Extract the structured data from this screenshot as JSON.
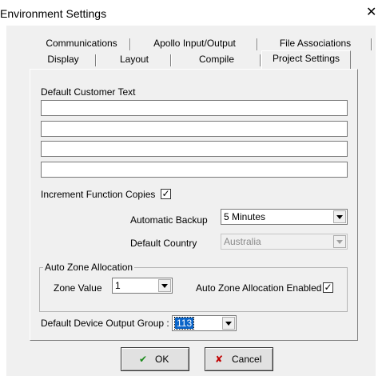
{
  "window": {
    "title": "Environment Settings"
  },
  "tabs": {
    "row1": [
      "Communications",
      "Apollo Input/Output",
      "File Associations"
    ],
    "row2": [
      "Display",
      "Layout",
      "Compile",
      "Project Settings"
    ],
    "active": "Project Settings"
  },
  "customer_text": {
    "label": "Default Customer Text",
    "lines": [
      "",
      "",
      "",
      ""
    ]
  },
  "increment_copies": {
    "label": "Increment Function Copies",
    "checked": true,
    "mark": "✓"
  },
  "auto_backup": {
    "label": "Automatic Backup",
    "value": "5 Minutes"
  },
  "default_country": {
    "label": "Default Country",
    "value": "Australia",
    "enabled": false
  },
  "auto_zone": {
    "group_label": "Auto Zone Allocation",
    "zone_value_label": "Zone Value",
    "zone_value": "1",
    "enabled_label": "Auto Zone Allocation Enabled",
    "enabled_checked": true,
    "enabled_mark": "✓"
  },
  "output_group": {
    "label": "Default Device Output Group :",
    "value": "113"
  },
  "buttons": {
    "ok_label": "OK",
    "cancel_label": "Cancel"
  },
  "colors": {
    "ok_accent": "#1a8a1a",
    "cancel_accent": "#c00000",
    "selection": "#0a64c8"
  }
}
